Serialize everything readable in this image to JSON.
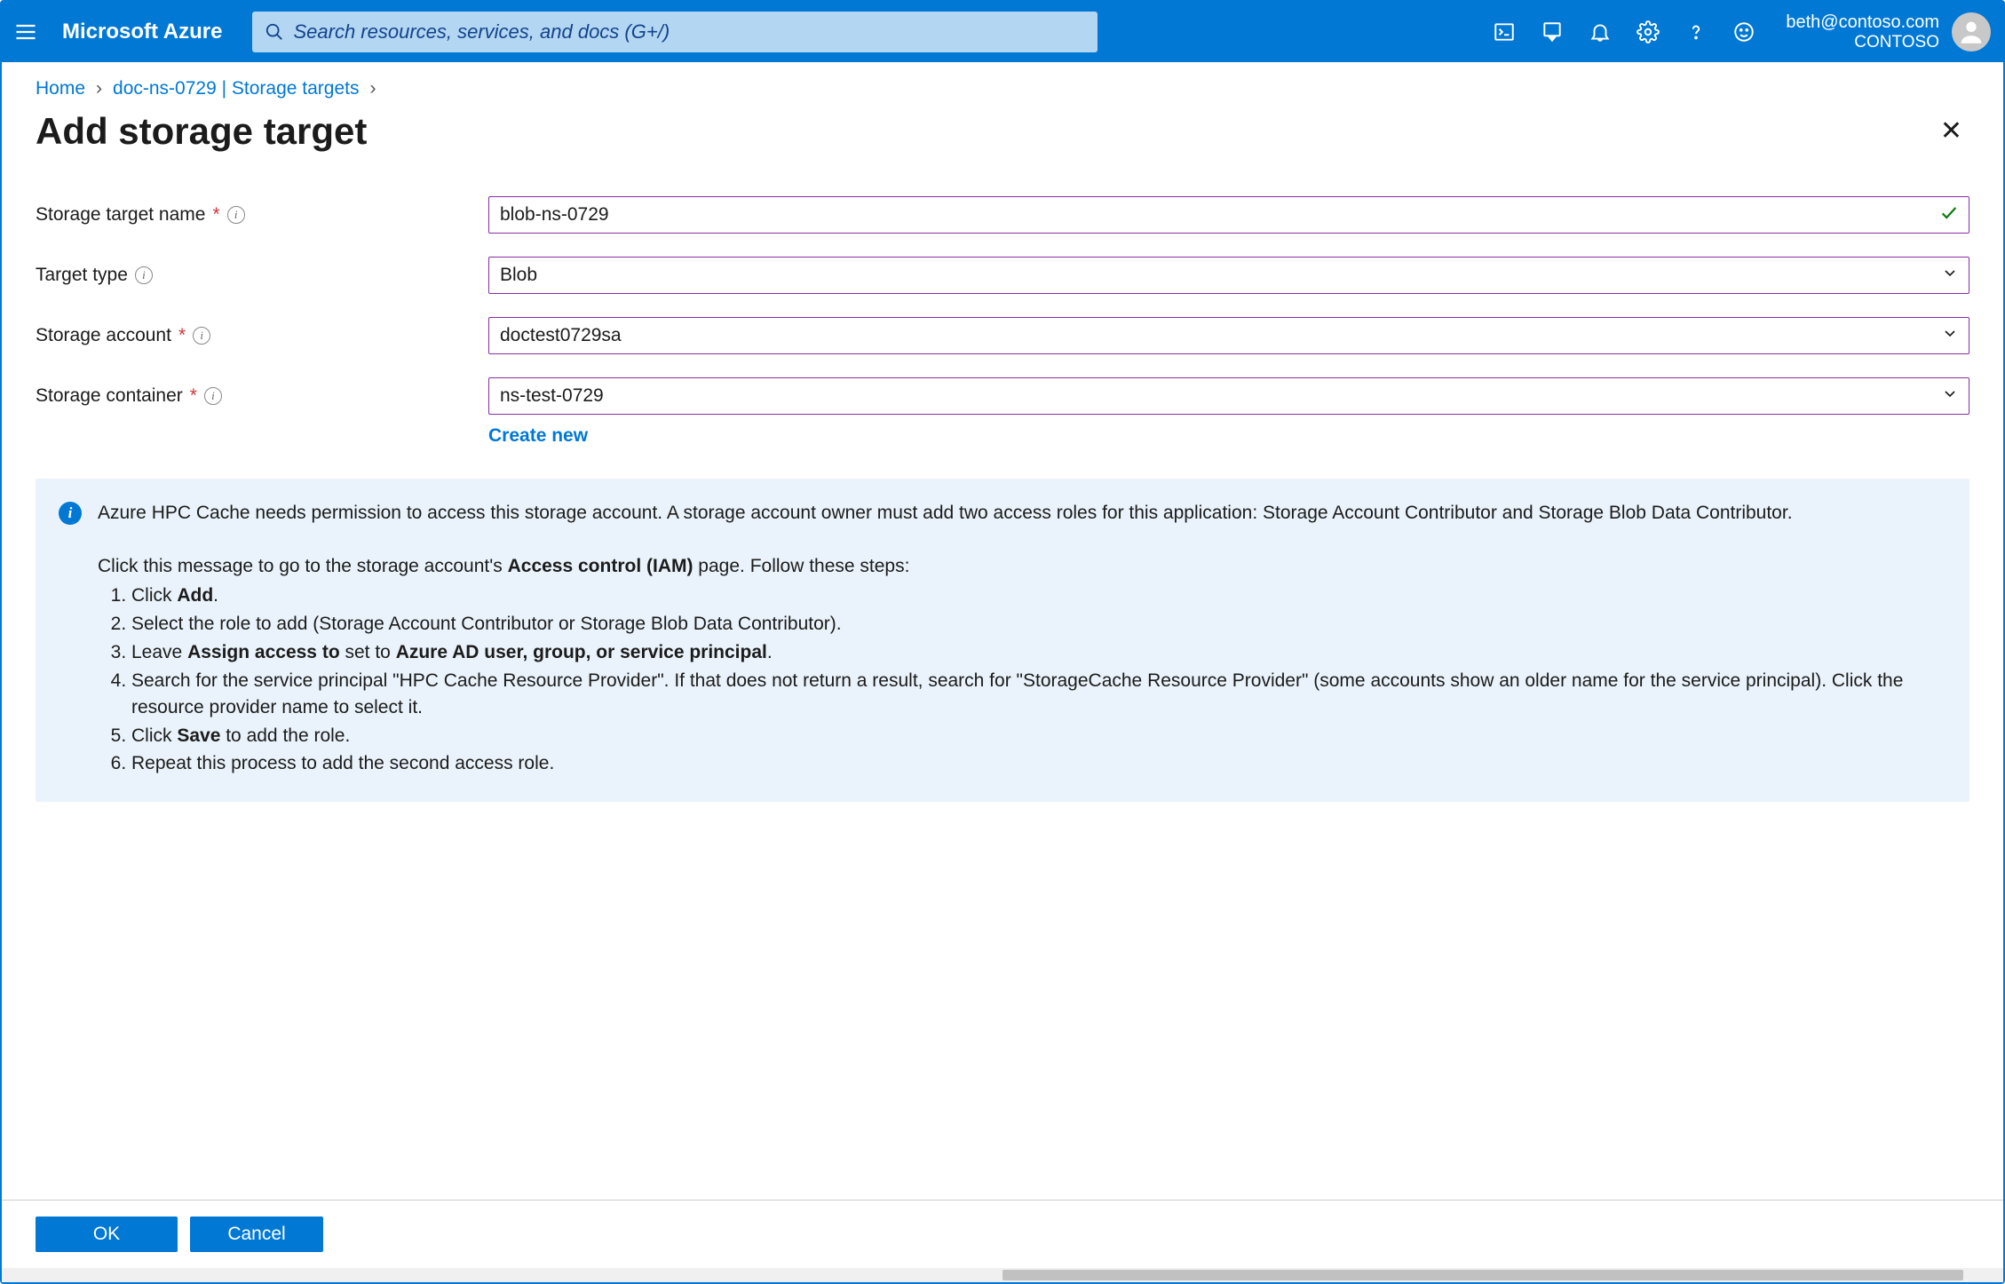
{
  "header": {
    "brand": "Microsoft Azure",
    "search_placeholder": "Search resources, services, and docs (G+/)",
    "user_email": "beth@contoso.com",
    "directory": "CONTOSO"
  },
  "breadcrumbs": {
    "home": "Home",
    "resource": "doc-ns-0729 | Storage targets"
  },
  "page": {
    "title": "Add storage target"
  },
  "form": {
    "name_label": "Storage target name",
    "name_value": "blob-ns-0729",
    "type_label": "Target type",
    "type_value": "Blob",
    "account_label": "Storage account",
    "account_value": "doctest0729sa",
    "container_label": "Storage container",
    "container_value": "ns-test-0729",
    "create_new": "Create new"
  },
  "info": {
    "intro": "Azure HPC Cache needs permission to access this storage account. A storage account owner must add two access roles for this application: Storage Account Contributor and Storage Blob Data Contributor.",
    "click_prefix": "Click this message to go to the storage account's ",
    "click_bold": "Access control (IAM)",
    "click_suffix": " page. Follow these steps:",
    "step1_a": "Click ",
    "step1_b": "Add",
    "step1_c": ".",
    "step2": "Select the role to add (Storage Account Contributor or Storage Blob Data Contributor).",
    "step3_a": "Leave ",
    "step3_b": "Assign access to",
    "step3_c": " set to ",
    "step3_d": "Azure AD user, group, or service principal",
    "step3_e": ".",
    "step4": "Search for the service principal \"HPC Cache Resource Provider\". If that does not return a result, search for \"StorageCache Resource Provider\" (some accounts show an older name for the service principal). Click the resource provider name to select it.",
    "step5_a": "Click ",
    "step5_b": "Save",
    "step5_c": " to add the role.",
    "step6": "Repeat this process to add the second access role."
  },
  "footer": {
    "ok": "OK",
    "cancel": "Cancel"
  }
}
